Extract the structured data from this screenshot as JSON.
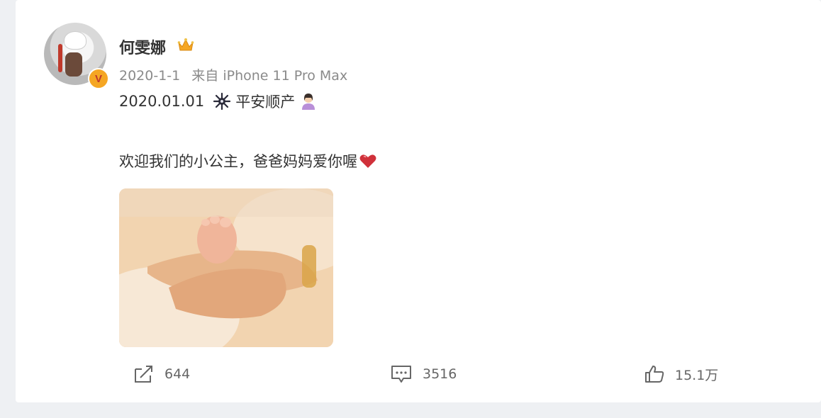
{
  "post": {
    "author": "何雯娜",
    "date": "2020-1-1",
    "source": "来自 iPhone 11 Pro Max",
    "line1_text": "2020.01.01",
    "line1_suffix": "平安顺产",
    "line2_text": "欢迎我们的小公主，爸爸妈妈爱你喔",
    "verify_badge": "V",
    "icons": {
      "crown": "crown-icon",
      "firework": "firework-emoji-icon",
      "person": "person-emoji-icon",
      "heart": "heart-emoji-icon"
    }
  },
  "actions": {
    "repost_count": "644",
    "comment_count": "3516",
    "like_count": "15.1万"
  },
  "colors": {
    "accent_badge": "#f5a623",
    "text_primary": "#333333",
    "text_meta": "#8a8a8a",
    "heart": "#d0313a"
  }
}
